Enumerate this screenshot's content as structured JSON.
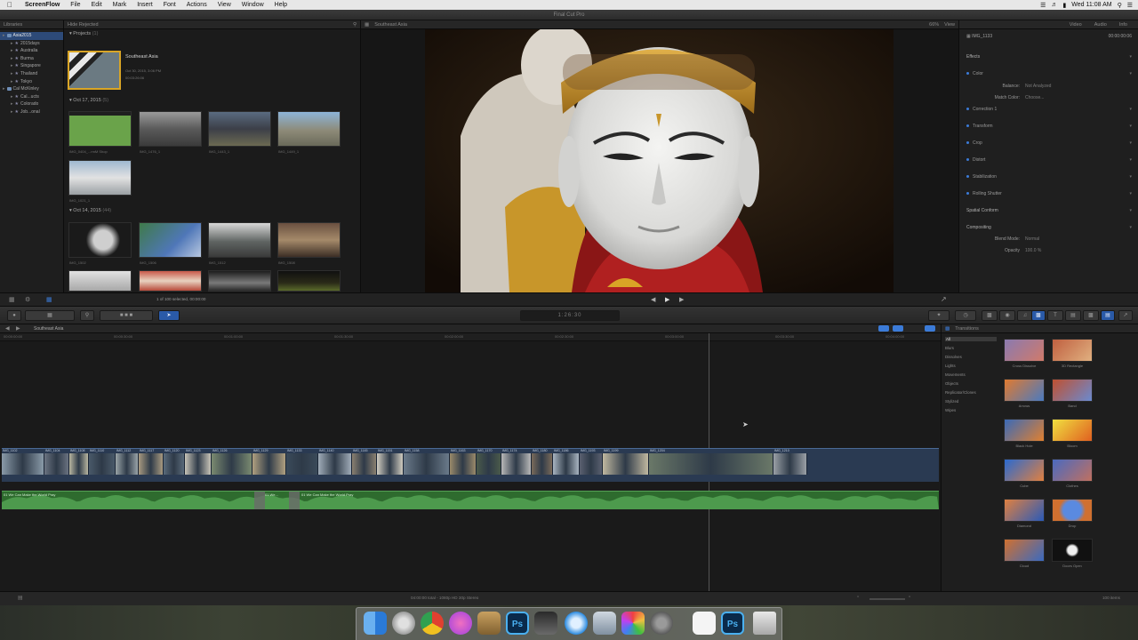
{
  "menu_bar": {
    "apple": "",
    "app_name": "ScreenFlow",
    "items": [
      "File",
      "Edit",
      "Mark",
      "Insert",
      "Font",
      "Actions",
      "View",
      "Window",
      "Help"
    ],
    "clock": "Wed 11:08 AM"
  },
  "window": {
    "title": "Final Cut Pro"
  },
  "libraries": {
    "header": "Libraries",
    "items": [
      {
        "label": "Asia2015",
        "selected": true,
        "level": 0
      },
      {
        "label": "2015days",
        "level": 1
      },
      {
        "label": "Australia",
        "level": 1
      },
      {
        "label": "Burma",
        "level": 1
      },
      {
        "label": "Singapore",
        "level": 1
      },
      {
        "label": "Thailand",
        "level": 1
      },
      {
        "label": "Tokyo",
        "level": 1
      },
      {
        "label": "Cal McKinley",
        "level": 0
      },
      {
        "label": "Cal...ucts",
        "level": 1
      },
      {
        "label": "Colorado",
        "level": 1
      },
      {
        "label": "Job...onal",
        "level": 1
      }
    ]
  },
  "browser": {
    "filter": "Hide Rejected",
    "projects_label": "Projects",
    "projects_count": "(1)",
    "project": {
      "name": "Southeast Asia",
      "meta1": "Oct 30, 2015, 3:06 PM",
      "meta2": "00:03:26:06"
    },
    "group1": {
      "label": "Oct 17, 2015",
      "count": "(5)"
    },
    "group2": {
      "label": "Oct 14, 2015",
      "count": "(44)"
    },
    "clips_row1": [
      "IMG_0404_...rmM Shop",
      "IMG_1476_1",
      "IMG_1443_1",
      "IMG_1449_1"
    ],
    "clips_row2": [
      "IMG_1021_1"
    ],
    "clips_row3": [
      "IMG_1502",
      "IMG_1506",
      "IMG_1512",
      "IMG_1508"
    ],
    "selection": "1 of 100 selected, 00:00:00"
  },
  "viewer": {
    "header": "Southeast Asia",
    "zoom": "66%",
    "view_label": "View"
  },
  "inspector": {
    "tabs": [
      "Video",
      "Audio",
      "Info"
    ],
    "clip_name": "IMG_1133",
    "timecode": "00:00:00:06",
    "rows": [
      {
        "label": "Effects",
        "value": ""
      },
      {
        "label": "Color",
        "value": ""
      },
      {
        "label": "Balance:",
        "value": "Not Analyzed"
      },
      {
        "label": "Match Color:",
        "value": "Choose..."
      },
      {
        "label": "Correction 1",
        "value": ""
      },
      {
        "label": "Transform",
        "value": ""
      },
      {
        "label": "Crop",
        "value": ""
      },
      {
        "label": "Distort",
        "value": ""
      },
      {
        "label": "Stabilization",
        "value": ""
      },
      {
        "label": "Rolling Shutter",
        "value": ""
      },
      {
        "label": "Spatial Conform",
        "value": ""
      },
      {
        "label": "Compositing",
        "value": ""
      },
      {
        "label": "Blend Mode:",
        "value": "Normal"
      },
      {
        "label": "Opacity",
        "value": "100.0 %"
      }
    ]
  },
  "toolbar": {
    "timecode": "1:26:30"
  },
  "timeline": {
    "project_name": "Southeast Asia",
    "ruler": [
      "00:00:00:00",
      "00:00:30:00",
      "00:01:00:00",
      "00:01:30:00",
      "00:02:00:00",
      "00:02:30:00",
      "00:03:00:00",
      "00:03:30:00",
      "00:04:00:00"
    ],
    "clip_names": [
      "IMG_1102",
      "IMG_1104",
      "IMG_1108",
      "IMG_1110",
      "IMG_1112",
      "IMG_1117",
      "IMG_1120",
      "IMG_1123",
      "IMG_1126",
      "IMG_1129",
      "IMG_1133",
      "IMG_1140",
      "IMG_1145",
      "IMG_1151",
      "IMG_1158",
      "IMG_1163",
      "IMG_1170",
      "IMG_1174",
      "IMG_1180",
      "IMG_1186",
      "IMG_1193",
      "IMG_1199",
      "IMG_1204",
      "IMG_1210"
    ],
    "music": [
      {
        "label": "01 We Can Make the World Pray"
      },
      {
        "label": "01 We..."
      },
      {
        "label": "01 We Can Make the World Pray"
      }
    ],
    "status": "04:00:00 total - 1080p HD 30p Stereo"
  },
  "transitions": {
    "header": "Transitions",
    "categories": [
      "All",
      "Blurs",
      "Dissolves",
      "Lights",
      "Movements",
      "Objects",
      "Replicator/Clones",
      "Stylized",
      "Wipes"
    ],
    "items": [
      "Cross Dissolve",
      "3D Rectangle",
      "Arrows",
      "Band",
      "Black Hole",
      "Bloom",
      "Cube",
      "Clothes",
      "Diamond",
      "Drop",
      "Cloud",
      "Doors Open"
    ],
    "count": "100 items"
  },
  "dock": {
    "icons": [
      "finder-icon",
      "launchpad-icon",
      "chrome-icon",
      "itunes-icon",
      "keychain-icon",
      "photoshop-icon",
      "final-cut-icon",
      "quicktime-icon",
      "preview-icon",
      "photos-icon",
      "system-preferences-icon",
      "document-icon",
      "photoshop-file-icon",
      "trash-icon"
    ],
    "ps_label": "Ps"
  }
}
